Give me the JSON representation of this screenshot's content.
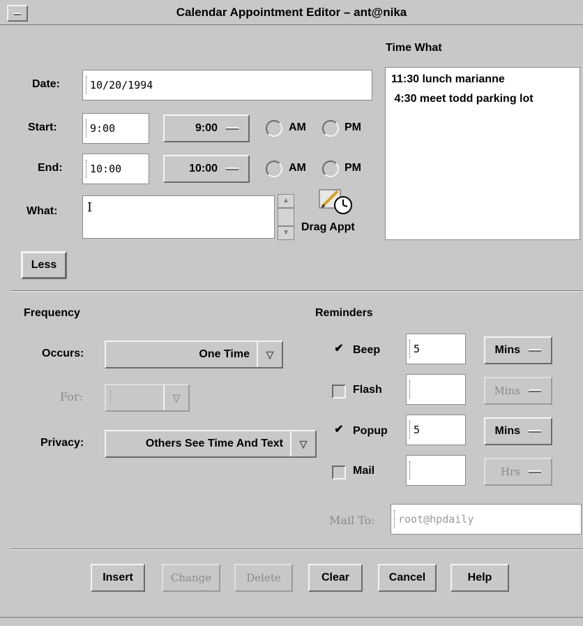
{
  "window": {
    "title": "Calendar Appointment Editor –  ant@nika"
  },
  "form": {
    "date_label": "Date:",
    "date_value": "10/20/1994",
    "start_label": "Start:",
    "start_value": "9:00",
    "start_menu": "9:00",
    "end_label": "End:",
    "end_value": "10:00",
    "end_menu": "10:00",
    "am": "AM",
    "pm": "PM",
    "what_label": "What:",
    "what_value": "",
    "drag_appt": "Drag Appt",
    "less_button": "Less"
  },
  "list": {
    "header": "Time  What",
    "items": [
      "11:30 lunch marianne",
      " 4:30 meet todd parking lot"
    ]
  },
  "frequency": {
    "heading": "Frequency",
    "occurs_label": "Occurs:",
    "occurs_value": "One Time",
    "for_label": "For:",
    "for_value": "",
    "privacy_label": "Privacy:",
    "privacy_value": "Others See Time And Text"
  },
  "reminders": {
    "heading": "Reminders",
    "items": [
      {
        "label": "Beep",
        "checked": true,
        "value": "5",
        "unit": "Mins",
        "enabled": true
      },
      {
        "label": "Flash",
        "checked": false,
        "value": "",
        "unit": "Mins",
        "enabled": false
      },
      {
        "label": "Popup",
        "checked": true,
        "value": "5",
        "unit": "Mins",
        "enabled": true
      },
      {
        "label": "Mail",
        "checked": false,
        "value": "",
        "unit": "Hrs",
        "enabled": false
      }
    ],
    "mailto_label": "Mail To:",
    "mailto_value": "root@hpdaily"
  },
  "buttons": {
    "insert": "Insert",
    "change": "Change",
    "delete": "Delete",
    "clear": "Clear",
    "cancel": "Cancel",
    "help": "Help"
  },
  "check_glyph": "✔"
}
